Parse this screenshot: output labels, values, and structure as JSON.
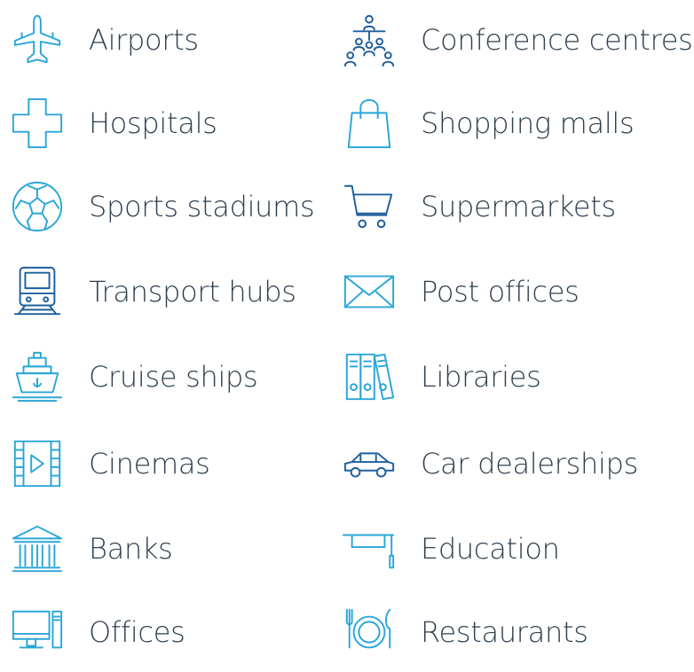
{
  "colors": {
    "icon_light": "#2aa6d8",
    "icon_dark": "#1d5f9e",
    "text": "#2f3f4f"
  },
  "left_column": [
    {
      "label": "Airports",
      "icon": "airplane-icon"
    },
    {
      "label": "Hospitals",
      "icon": "medical-cross-icon"
    },
    {
      "label": "Sports stadiums",
      "icon": "soccer-ball-icon"
    },
    {
      "label": "Transport hubs",
      "icon": "train-icon"
    },
    {
      "label": "Cruise ships",
      "icon": "cruise-ship-icon"
    },
    {
      "label": "Cinemas",
      "icon": "film-strip-icon"
    },
    {
      "label": "Banks",
      "icon": "bank-building-icon"
    },
    {
      "label": "Offices",
      "icon": "desktop-computer-icon"
    }
  ],
  "right_column": [
    {
      "label": "Conference centres",
      "icon": "conference-icon"
    },
    {
      "label": "Shopping malls",
      "icon": "shopping-bag-icon"
    },
    {
      "label": "Supermarkets",
      "icon": "shopping-cart-icon"
    },
    {
      "label": "Post offices",
      "icon": "envelope-icon"
    },
    {
      "label": "Libraries",
      "icon": "binders-icon"
    },
    {
      "label": "Car dealerships",
      "icon": "car-icon"
    },
    {
      "label": "Education",
      "icon": "graduation-cap-icon"
    },
    {
      "label": "Restaurants",
      "icon": "plate-cutlery-icon"
    }
  ]
}
